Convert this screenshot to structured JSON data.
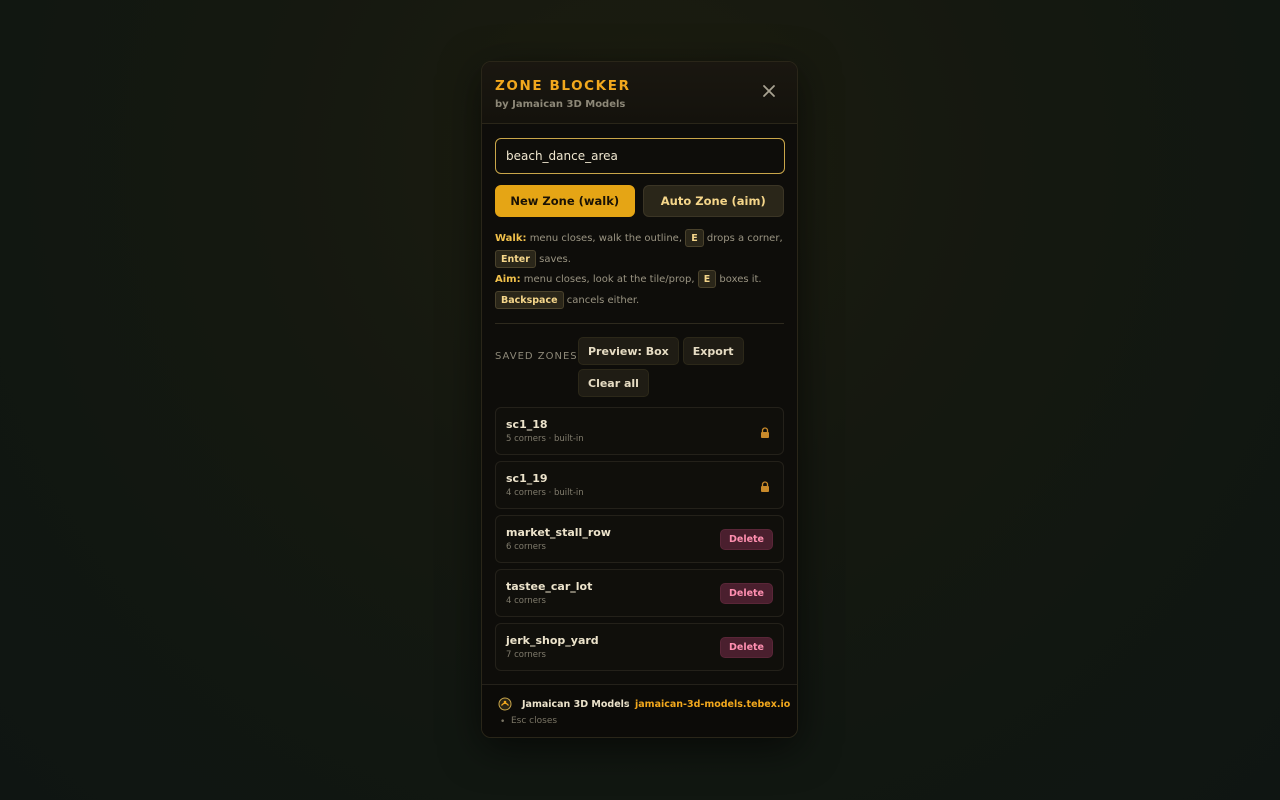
{
  "header": {
    "title": "ZONE BLOCKER",
    "subtitle": "by Jamaican 3D Models"
  },
  "input": {
    "value": "beach_dance_area"
  },
  "buttons": {
    "new_zone": "New Zone (walk)",
    "auto_zone": "Auto Zone (aim)"
  },
  "help": {
    "walk_label": "Walk:",
    "walk_text1": "menu closes, walk the outline,",
    "walk_key1": "E",
    "walk_text2": "drops a corner,",
    "walk_key2": "Enter",
    "walk_text3": "saves.",
    "aim_label": "Aim:",
    "aim_text1": "menu closes, look at the tile/prop,",
    "aim_key1": "E",
    "aim_text2": "boxes it.",
    "aim_key2": "Backspace",
    "aim_text3": "cancels either."
  },
  "saved": {
    "label": "SAVED ZONES",
    "actions": [
      "Preview: Box",
      "Export",
      "Clear all"
    ]
  },
  "zones": [
    {
      "name": "sc1_18",
      "meta": "5 corners · built-in",
      "locked": true
    },
    {
      "name": "sc1_19",
      "meta": "4 corners · built-in",
      "locked": true
    },
    {
      "name": "market_stall_row",
      "meta": "6 corners",
      "locked": false,
      "delete_label": "Delete"
    },
    {
      "name": "tastee_car_lot",
      "meta": "4 corners",
      "locked": false,
      "delete_label": "Delete"
    },
    {
      "name": "jerk_shop_yard",
      "meta": "7 corners",
      "locked": false,
      "delete_label": "Delete"
    }
  ],
  "footer": {
    "brand": "Jamaican 3D Models",
    "separator": "•",
    "site": "jamaican-3d-models.tebex.io",
    "esc_hint": "Esc closes"
  },
  "icons": {
    "close": "close-icon",
    "lock": "lock-icon",
    "logo": "brand-logo-icon"
  },
  "colors": {
    "accent": "#f2a81d",
    "primary_button": "#e5a515",
    "delete_text": "#ff8fb0",
    "delete_bg": "#4a1f2e"
  }
}
